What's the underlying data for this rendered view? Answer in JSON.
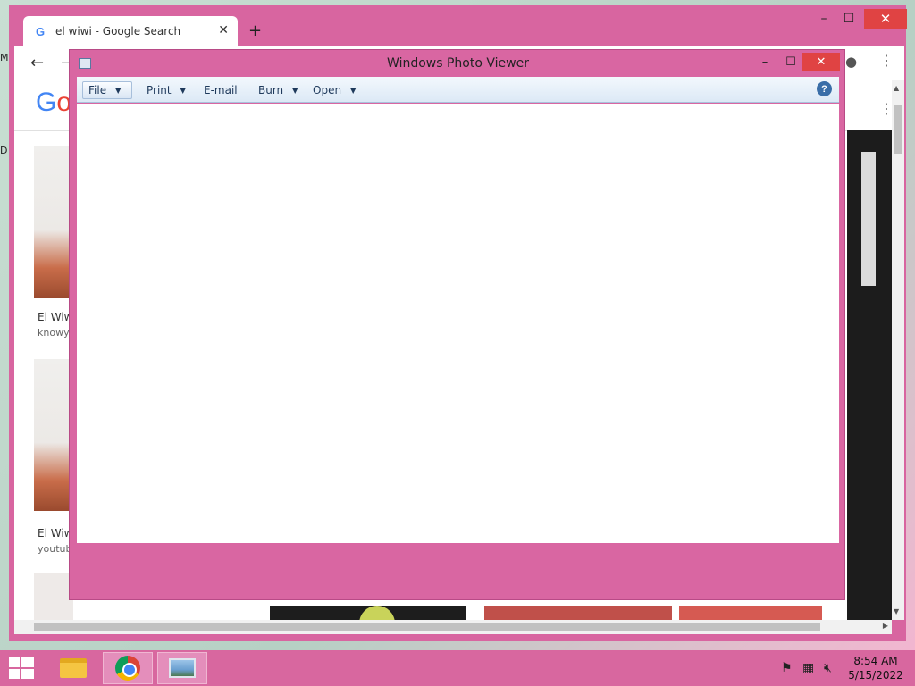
{
  "desktop": {
    "edge_text_1": "M",
    "edge_text_2": "D"
  },
  "chrome": {
    "tab_title": "el wiwi - Google Search",
    "tab_favicon": "G",
    "new_tab_label": "+",
    "window_controls": {
      "minimize": "–",
      "maximize": "☐",
      "close": "✕"
    },
    "tab_close": "✕",
    "nav": {
      "back": "←",
      "forward": "→",
      "menu": "⋮",
      "apps": "⋮⋮"
    },
    "logo": {
      "g": "G",
      "o": "o"
    },
    "results": [
      {
        "title": "El Wiw",
        "source": "knowyo"
      },
      {
        "title": "El Wiw",
        "source": "youtub"
      }
    ]
  },
  "photo_viewer": {
    "title": "Windows Photo Viewer",
    "window_controls": {
      "minimize": "–",
      "maximize": "☐",
      "close": "✕"
    },
    "toolbar": {
      "file": "File",
      "print": "Print",
      "email": "E-mail",
      "burn": "Burn",
      "open": "Open",
      "dropdown_arrow": "▼",
      "help": "?"
    }
  },
  "taskbar": {
    "time": "8:54 AM",
    "date": "5/15/2022",
    "tray_icons": [
      "flag-icon",
      "network-icon",
      "volume-muted-icon"
    ]
  }
}
